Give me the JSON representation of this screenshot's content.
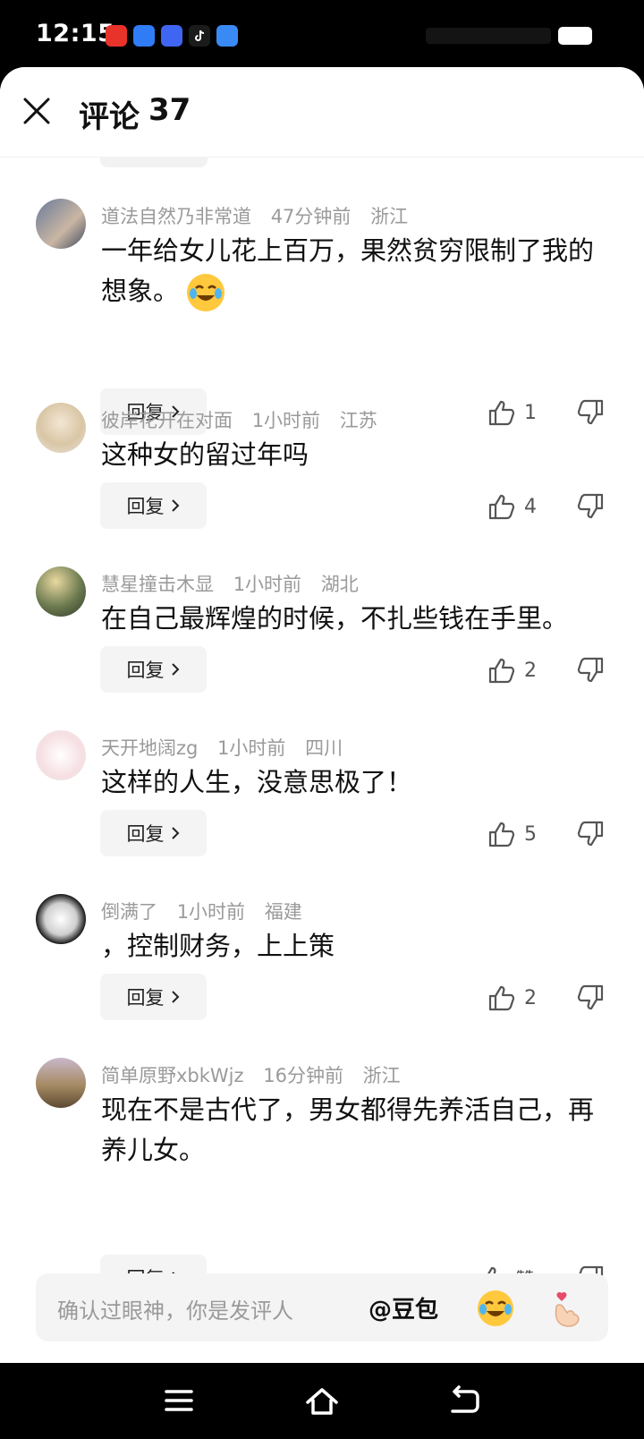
{
  "status": {
    "time": "12:15",
    "app_icons": [
      "app-icon-1",
      "app-icon-2",
      "app-icon-3",
      "tiktok-icon",
      "app-icon-5"
    ]
  },
  "header": {
    "title": "评论",
    "count": "37"
  },
  "comments": [
    {
      "user": "道法自然乃非常道",
      "time": "47分钟前",
      "region": "浙江",
      "text": "一年给女儿花上百万，果然贫穷限制了我的想象。",
      "emoji": "laugh-cry-emoji",
      "reply": "回复",
      "likes": "1"
    },
    {
      "user": "彼岸花开在对面",
      "time": "1小时前",
      "region": "江苏",
      "text": "这种女的留过年吗",
      "reply": "回复",
      "likes": "4"
    },
    {
      "user": "慧星撞击木显",
      "time": "1小时前",
      "region": "湖北",
      "text": "在自己最辉煌的时候，不扎些钱在手里。",
      "reply": "回复",
      "likes": "2"
    },
    {
      "user": "天开地阔zg",
      "time": "1小时前",
      "region": "四川",
      "text": "这样的人生，没意思极了！",
      "reply": "回复",
      "likes": "5"
    },
    {
      "user": "倒满了",
      "time": "1小时前",
      "region": "福建",
      "text": "，控制财务，上上策",
      "reply": "回复",
      "likes": "2"
    },
    {
      "user": "简单原野xbkWjz",
      "time": "16分钟前",
      "region": "浙江",
      "text": "现在不是古代了，男女都得先养活自己，再养儿女。",
      "reply": "回复",
      "likes": "赞"
    }
  ],
  "input": {
    "placeholder": "确认过眼神，你是发评人",
    "mention": "@豆包",
    "emojis": [
      "laugh-cry-emoji",
      "finger-heart-emoji"
    ]
  },
  "navbar": {
    "icons": [
      "menu-icon",
      "home-icon",
      "back-icon"
    ]
  }
}
